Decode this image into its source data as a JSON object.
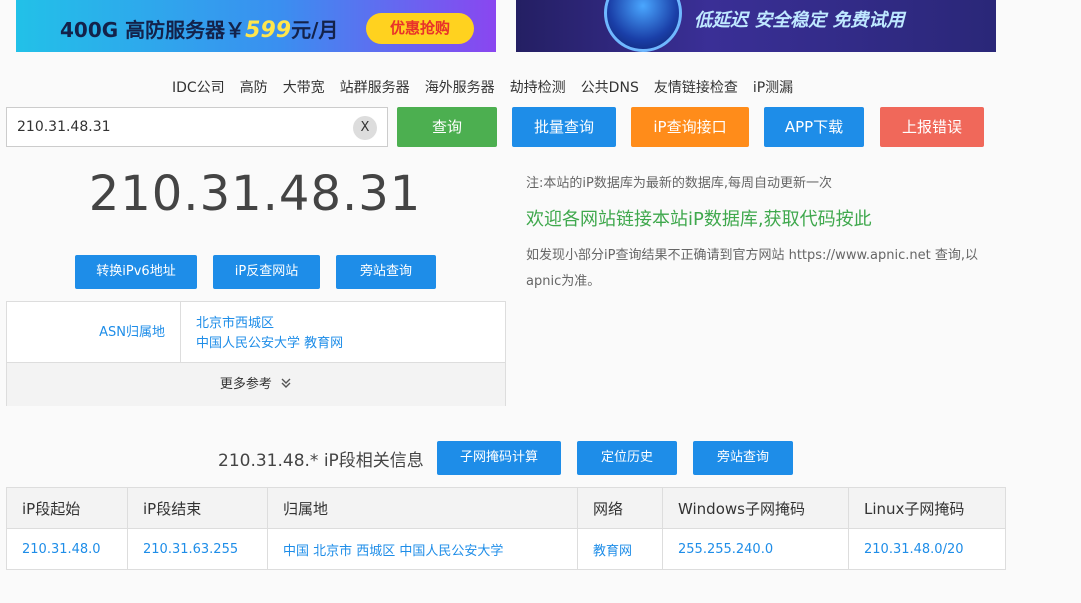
{
  "banners": {
    "left_text": "400G 高防服务器￥",
    "left_price": "599",
    "left_unit": "元/月",
    "left_button": "优惠抢购",
    "right_text": "低延迟  安全稳定  免费试用"
  },
  "nav": [
    "IDC公司",
    "高防",
    "大带宽",
    "站群服务器",
    "海外服务器",
    "劫持检测",
    "公共DNS",
    "友情链接检查",
    "iP测漏"
  ],
  "search": {
    "value": "210.31.48.31",
    "clear_label": "X",
    "buttons": {
      "query": "查询",
      "batch": "批量查询",
      "api": "iP查询接口",
      "app": "APP下载",
      "report": "上报错误"
    }
  },
  "result": {
    "ip": "210.31.48.31",
    "actions": [
      "转换iPv6地址",
      "iP反查网站",
      "旁站查询"
    ],
    "asn_label": "ASN归属地",
    "asn_line1": "北京市西城区",
    "asn_line2": "中国人民公安大学 教育网",
    "more_label": "更多参考"
  },
  "notes": {
    "update": "注:本站的iP数据库为最新的数据库,每周自动更新一次",
    "welcome": "欢迎各网站链接本站iP数据库,获取代码按此",
    "apnic": "如发现小部分iP查询结果不正确请到官方网站 https://www.apnic.net 查询,以apnic为准。"
  },
  "segment": {
    "title": "210.31.48.* iP段相关信息",
    "buttons": [
      "子网掩码计算",
      "定位历史",
      "旁站查询"
    ],
    "headers": [
      "iP段起始",
      "iP段结束",
      "归属地",
      "网络",
      "Windows子网掩码",
      "Linux子网掩码"
    ],
    "row": [
      "210.31.48.0",
      "210.31.63.255",
      "中国 北京市 西城区 中国人民公安大学",
      "教育网",
      "255.255.240.0",
      "210.31.48.0/20"
    ]
  },
  "colors": {
    "green": "#4caf50",
    "blue": "#1e8de8",
    "orange": "#ff8c1a",
    "red": "#f0685a",
    "accent_text": "#3fa84d"
  }
}
